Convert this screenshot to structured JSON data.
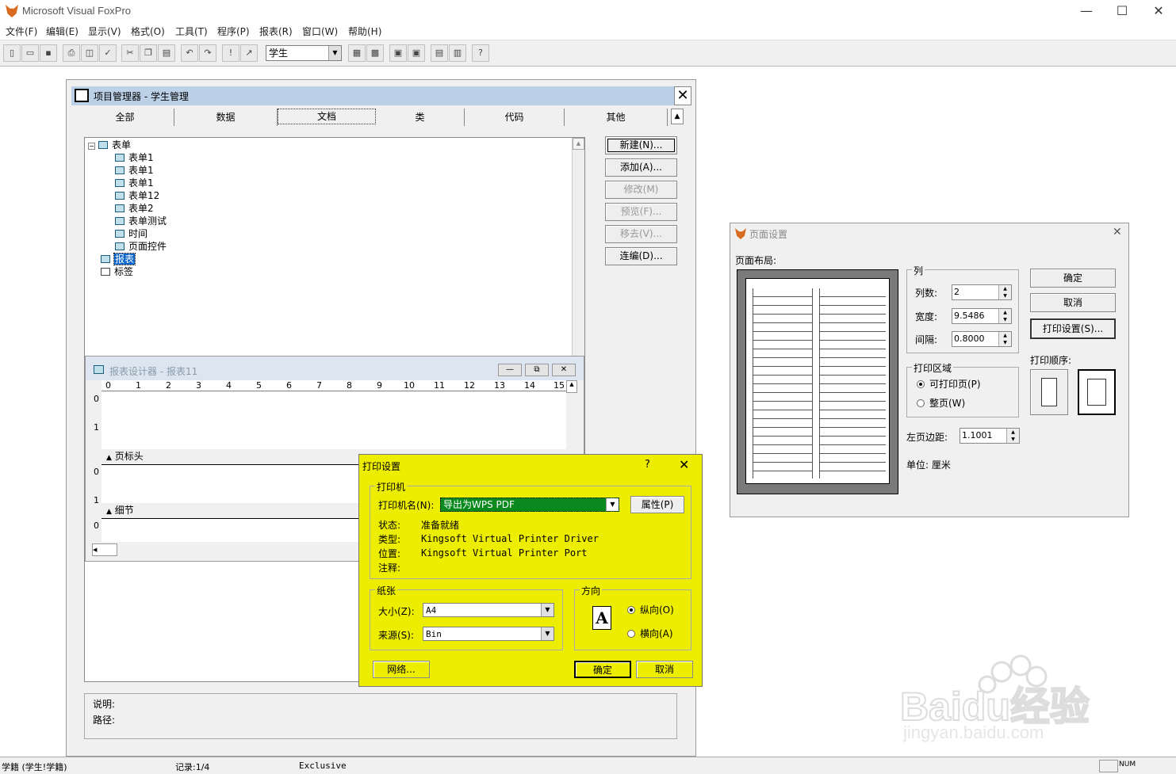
{
  "app": {
    "title": "Microsoft Visual FoxPro"
  },
  "menu": [
    "文件(F)",
    "编辑(E)",
    "显示(V)",
    "格式(O)",
    "工具(T)",
    "程序(P)",
    "报表(R)",
    "窗口(W)",
    "帮助(H)"
  ],
  "toolbar": {
    "combo_value": "学生"
  },
  "project": {
    "title": "项目管理器 - 学生管理",
    "tabs": [
      "全部",
      "数据",
      "文档",
      "类",
      "代码",
      "其他"
    ],
    "active_tab": "文档",
    "tree": {
      "root": "表单",
      "forms": [
        "表单1",
        "表单1",
        "表单1",
        "表单12",
        "表单2",
        "表单测试",
        "时间",
        "页面控件"
      ],
      "reports": "报表",
      "labels": "标签"
    },
    "buttons": [
      "新建(N)...",
      "添加(A)...",
      "修改(M)",
      "预览(F)...",
      "移去(V)...",
      "连编(D)..."
    ],
    "info_desc_label": "说明:",
    "info_path_label": "路径:"
  },
  "report_designer": {
    "title": "报表设计器 - 报表11",
    "ruler": [
      "0",
      "1",
      "2",
      "3",
      "4",
      "5",
      "6",
      "7",
      "8",
      "9",
      "10",
      "11",
      "12",
      "13",
      "14",
      "15"
    ],
    "band_header": "页标头",
    "band_detail": "细节",
    "vruler": [
      "0",
      "1",
      "0",
      "1",
      "0"
    ]
  },
  "page_setup": {
    "title": "页面设置",
    "layout_label": "页面布局:",
    "col_group": "列",
    "cols_label": "列数:",
    "cols_value": "2",
    "width_label": "宽度:",
    "width_value": "9.5486",
    "gap_label": "间隔:",
    "gap_value": "0.8000",
    "area_group": "打印区域",
    "area_opt1": "可打印页(P)",
    "area_opt2": "整页(W)",
    "margin_label": "左页边距:",
    "margin_value": "1.1001",
    "unit_text": "单位: 厘米",
    "ok": "确定",
    "cancel": "取消",
    "print_setup": "打印设置(S)...",
    "order_label": "打印顺序:"
  },
  "print_setup": {
    "title": "打印设置",
    "help": "?",
    "printer_group": "打印机",
    "name_label": "打印机名(N):",
    "name_value": "导出为WPS PDF",
    "props_button": "属性(P)",
    "status_label": "状态:",
    "status_value": "准备就绪",
    "type_label": "类型:",
    "type_value": "Kingsoft Virtual Printer Driver",
    "where_label": "位置:",
    "where_value": "Kingsoft Virtual Printer Port",
    "comment_label": "注释:",
    "paper_group": "纸张",
    "size_label": "大小(Z):",
    "size_value": "A4",
    "source_label": "来源(S):",
    "source_value": "Bin",
    "orient_group": "方向",
    "portrait": "纵向(O)",
    "landscape": "横向(A)",
    "network_button": "网络...",
    "ok": "确定",
    "cancel": "取消"
  },
  "status": {
    "left": "学籍 (学生!学籍)",
    "record": "记录:1/4",
    "mode": "Exclusive",
    "num": "NUM"
  },
  "watermark": {
    "brand": "Baidu经验",
    "url": "jingyan.baidu.com"
  },
  "colors": {
    "highlight": "#eded00",
    "title_active": "#bcd0e8",
    "combo_selected": "#0a8a1e"
  }
}
